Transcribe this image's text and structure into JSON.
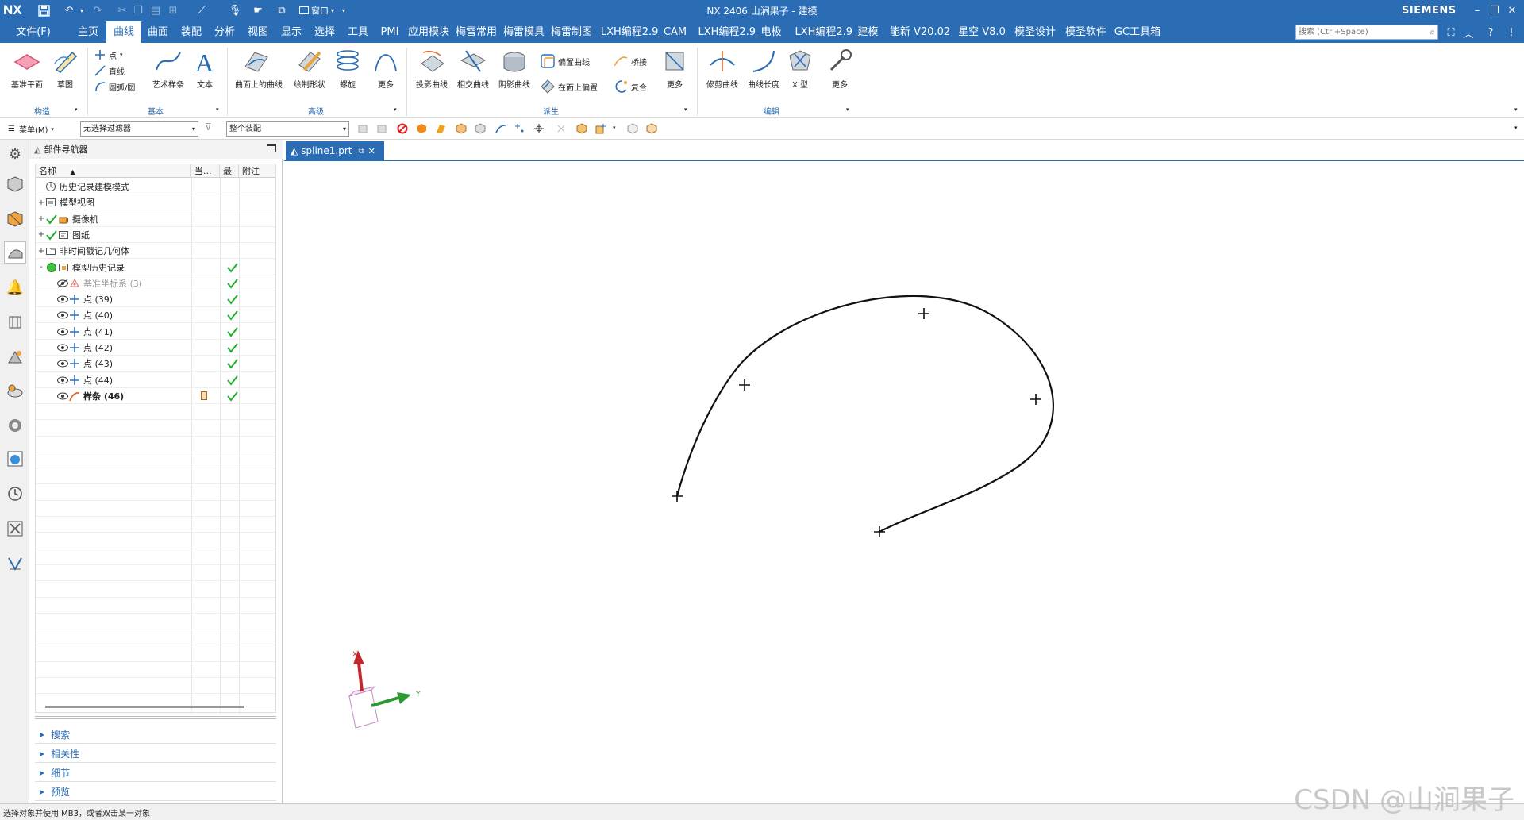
{
  "app": {
    "logo": "NX",
    "window_title": "NX 2406 山涧果子 - 建模",
    "brand": "SIEMENS",
    "window_menu_label": "窗口"
  },
  "menubar": {
    "file_label": "文件(F)",
    "tabs": [
      "主页",
      "曲线",
      "曲面",
      "装配",
      "分析",
      "视图",
      "显示",
      "选择",
      "工具",
      "PMI",
      "应用模块",
      "梅雷常用",
      "梅雷模具",
      "梅雷制图",
      "LXH编程2.9_CAM",
      "LXH编程2.9_电极",
      "LXH编程2.9_建模",
      "能新 V20.02",
      "星空 V8.0",
      "模圣设计",
      "模圣软件",
      "GC工具箱"
    ],
    "active_tab": "曲线",
    "search_placeholder": "搜索 (Ctrl+Space)"
  },
  "ribbon": {
    "construct": {
      "datum_plane": "基准平面",
      "sketch": "草图",
      "group": "构造"
    },
    "basic": {
      "point": "点",
      "line": "直线",
      "arc": "圆弧/圆",
      "art_spline": "艺术样条",
      "text": "文本",
      "group": "基本"
    },
    "advanced": {
      "curve_on_surface": "曲面上的曲线",
      "draw_shape": "绘制形状",
      "helix": "螺旋",
      "more": "更多",
      "group": "高级"
    },
    "derived": {
      "project_curve": "投影曲线",
      "intersect_curve": "相交曲线",
      "isocline": "阴影曲线",
      "offset_curve": "偏置曲线",
      "offset_on_face": "在面上偏置",
      "bridge": "桥接",
      "composite": "复合",
      "more": "更多",
      "group": "派生"
    },
    "edit": {
      "trim_curve": "修剪曲线",
      "curve_length": "曲线长度",
      "x_form": "X 型",
      "more": "更多",
      "group": "编辑"
    }
  },
  "selection_bar": {
    "menu_label": "菜单(M)",
    "type_filter": "无选择过滤器",
    "scope": "整个装配"
  },
  "navigator": {
    "title": "部件导航器",
    "columns": [
      "名称",
      "当...",
      "最",
      "附注"
    ],
    "rows": [
      {
        "label": "历史记录建模模式",
        "expand": "",
        "icon": "clock",
        "check": false,
        "dim": false,
        "bold": false,
        "indent": 0
      },
      {
        "label": "模型视图",
        "expand": "+",
        "icon": "views",
        "check": false,
        "dim": false,
        "bold": false,
        "indent": 0
      },
      {
        "label": "摄像机",
        "expand": "+",
        "icon": "camera",
        "check": true,
        "dim": false,
        "bold": false,
        "indent": 0
      },
      {
        "label": "图纸",
        "expand": "+",
        "icon": "drawing",
        "check": true,
        "dim": false,
        "bold": false,
        "indent": 0
      },
      {
        "label": "非时间戳记几何体",
        "expand": "+",
        "icon": "folder",
        "check": false,
        "dim": false,
        "bold": false,
        "indent": 0
      },
      {
        "label": "模型历史记录",
        "expand": "-",
        "icon": "history",
        "check": false,
        "dim": false,
        "bold": false,
        "indent": 0,
        "last": true
      },
      {
        "label": "基准坐标系 (3)",
        "expand": "",
        "icon": "csys",
        "check": false,
        "dim": true,
        "bold": false,
        "indent": 1,
        "last": true
      },
      {
        "label": "点 (39)",
        "expand": "",
        "icon": "point",
        "check": false,
        "dim": false,
        "bold": false,
        "indent": 1,
        "last": true
      },
      {
        "label": "点 (40)",
        "expand": "",
        "icon": "point",
        "check": false,
        "dim": false,
        "bold": false,
        "indent": 1,
        "last": true
      },
      {
        "label": "点 (41)",
        "expand": "",
        "icon": "point",
        "check": false,
        "dim": false,
        "bold": false,
        "indent": 1,
        "last": true
      },
      {
        "label": "点 (42)",
        "expand": "",
        "icon": "point",
        "check": false,
        "dim": false,
        "bold": false,
        "indent": 1,
        "last": true
      },
      {
        "label": "点 (43)",
        "expand": "",
        "icon": "point",
        "check": false,
        "dim": false,
        "bold": false,
        "indent": 1,
        "last": true
      },
      {
        "label": "点 (44)",
        "expand": "",
        "icon": "point",
        "check": false,
        "dim": false,
        "bold": false,
        "indent": 1,
        "last": true
      },
      {
        "label": "样条 (46)",
        "expand": "",
        "icon": "spline",
        "check": false,
        "dim": false,
        "bold": true,
        "indent": 1,
        "last": true,
        "current": true
      }
    ],
    "sections": [
      "搜索",
      "相关性",
      "细节",
      "预览"
    ]
  },
  "viewport": {
    "tab_label": "spline1.prt",
    "axis_x": "X",
    "axis_y": "Y"
  },
  "status": {
    "prompt": "选择对象并使用 MB3，或者双击某一对象",
    "watermark": "CSDN @山涧果子"
  },
  "colors": {
    "accent": "#2a6db5",
    "check_green": "#1fae2c",
    "axis_x": "#c0282b",
    "axis_y": "#2e9a36"
  }
}
